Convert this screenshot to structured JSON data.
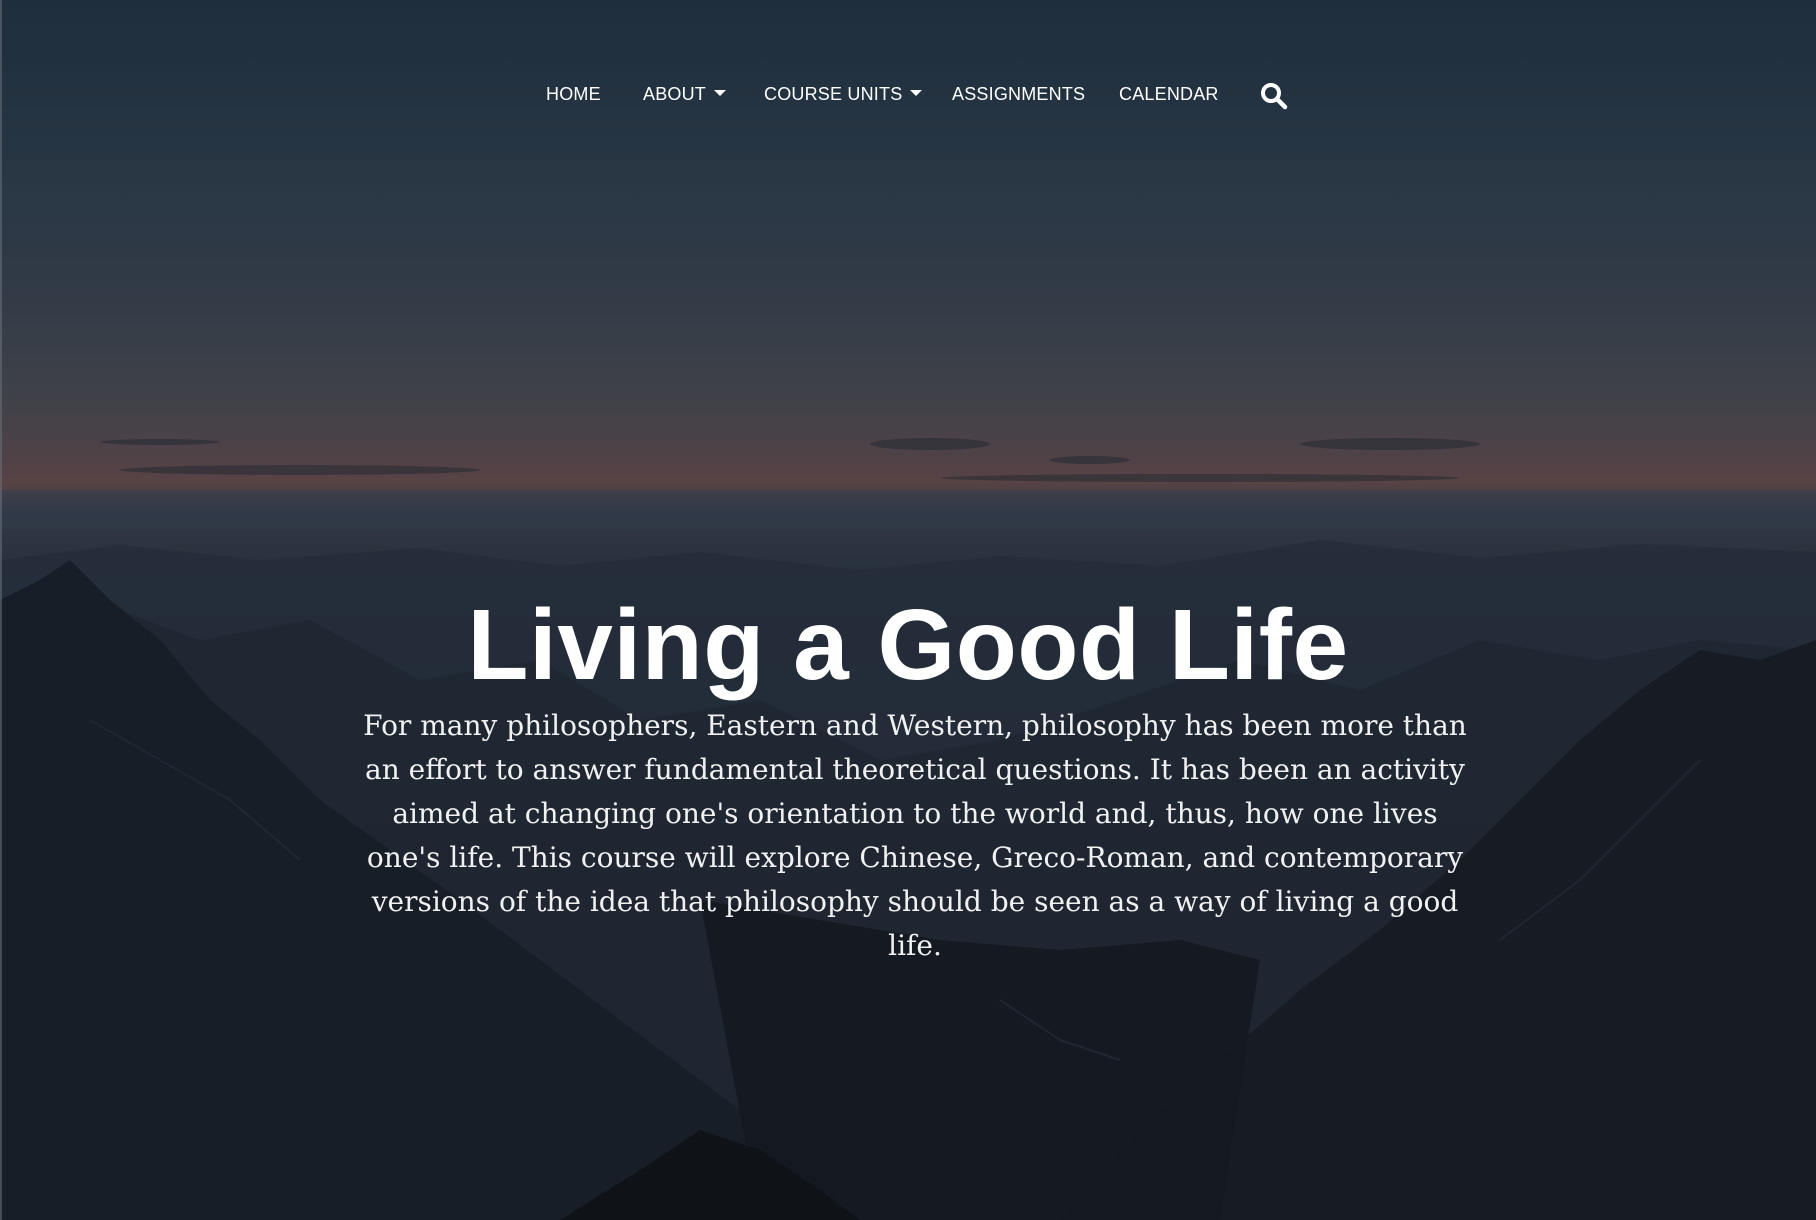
{
  "nav": {
    "items": [
      {
        "label": "HOME",
        "has_dropdown": false
      },
      {
        "label": "ABOUT",
        "has_dropdown": true
      },
      {
        "label": "COURSE UNITS",
        "has_dropdown": true
      },
      {
        "label": "ASSIGNMENTS",
        "has_dropdown": false
      },
      {
        "label": "CALENDAR",
        "has_dropdown": false
      }
    ],
    "search_icon": "search-icon"
  },
  "hero": {
    "title": "Living a Good Life",
    "intro": "For many philosophers, Eastern and Western, philosophy has been more than an effort to answer fundamental theoretical questions. It has been an activity aimed at changing one's orientation to the world and, thus, how one lives one's life. This course will explore Chinese, Greco-Roman, and contemporary versions of the idea that philosophy should be seen as a way of living a good life.",
    "background": "mountain landscape at dusk"
  },
  "colors": {
    "text": "#ffffff",
    "sky_top": "#233545",
    "horizon_glow": "#6a4f50",
    "mountains": "#15181f"
  }
}
